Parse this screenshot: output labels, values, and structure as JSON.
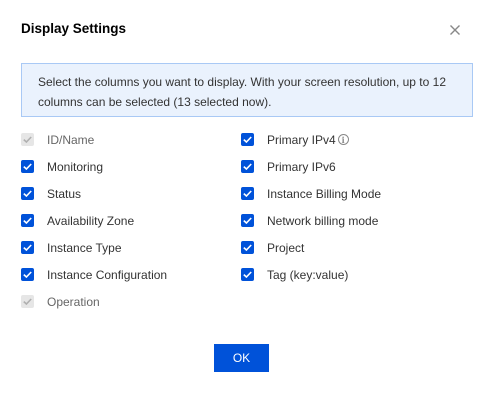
{
  "dialog": {
    "title": "Display Settings",
    "info_text": "Select the columns you want to display. With your screen resolution, up to 12 columns can be selected (13 selected now).",
    "ok_label": "OK"
  },
  "left_options": [
    {
      "label": "ID/Name",
      "checked": true,
      "disabled": true
    },
    {
      "label": "Monitoring",
      "checked": true,
      "disabled": false
    },
    {
      "label": "Status",
      "checked": true,
      "disabled": false
    },
    {
      "label": "Availability Zone",
      "checked": true,
      "disabled": false
    },
    {
      "label": "Instance Type",
      "checked": true,
      "disabled": false
    },
    {
      "label": "Instance Configuration",
      "checked": true,
      "disabled": false
    },
    {
      "label": "Operation",
      "checked": true,
      "disabled": true
    }
  ],
  "right_options": [
    {
      "label": "Primary IPv4",
      "checked": true,
      "disabled": false,
      "info_icon": true
    },
    {
      "label": "Primary IPv6",
      "checked": true,
      "disabled": false
    },
    {
      "label": "Instance Billing Mode",
      "checked": true,
      "disabled": false
    },
    {
      "label": "Network billing mode",
      "checked": true,
      "disabled": false
    },
    {
      "label": "Project",
      "checked": true,
      "disabled": false
    },
    {
      "label": "Tag (key:value)",
      "checked": true,
      "disabled": false
    }
  ],
  "icons": {
    "close": "close-icon",
    "info": "info-icon",
    "check": "check-icon"
  },
  "colors": {
    "accent": "#0052d9",
    "info_bg": "#eaf2fd",
    "info_border": "#a9c9f5",
    "disabled_check": "#e6e6e6"
  }
}
